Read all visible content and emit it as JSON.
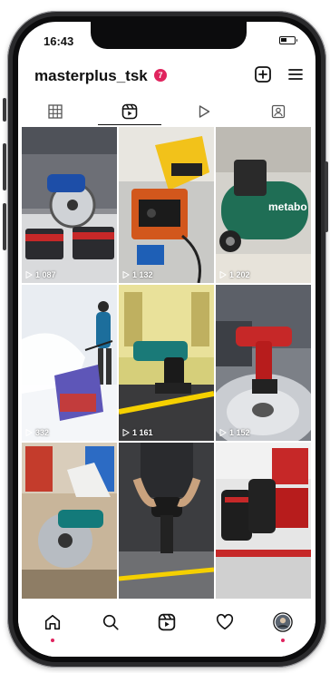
{
  "status": {
    "time": "16:43"
  },
  "profile": {
    "username": "masterplus_tsk",
    "notification_count": "7"
  },
  "tabs": [
    {
      "name": "grid",
      "icon": "grid-icon",
      "active": false
    },
    {
      "name": "reels",
      "icon": "reels-icon",
      "active": true
    },
    {
      "name": "videos",
      "icon": "play-icon",
      "active": false
    },
    {
      "name": "tagged",
      "icon": "tagged-icon",
      "active": false
    }
  ],
  "reels": [
    {
      "views": "1 087",
      "subject": "circular saw with batteries"
    },
    {
      "views": "1 132",
      "subject": "jigsaw and generator"
    },
    {
      "views": "1 202",
      "subject": "metabo air compressor"
    },
    {
      "views": "332",
      "subject": "snow blower in snow"
    },
    {
      "views": "1 161",
      "subject": "rotary hammer"
    },
    {
      "views": "1 152",
      "subject": "impact wrench on wheel"
    },
    {
      "views": "",
      "subject": "circular saw cutting"
    },
    {
      "views": "",
      "subject": "cordless drill"
    },
    {
      "views": "",
      "subject": "tool bags display"
    }
  ],
  "compressor_brand": "metabo",
  "bottom_nav": [
    {
      "name": "home",
      "icon": "home-icon"
    },
    {
      "name": "search",
      "icon": "search-icon"
    },
    {
      "name": "reels",
      "icon": "reels-icon"
    },
    {
      "name": "activity",
      "icon": "heart-icon"
    },
    {
      "name": "profile",
      "icon": "avatar-icon"
    }
  ],
  "colors": {
    "badge": "#e0245e",
    "text": "#111111"
  }
}
